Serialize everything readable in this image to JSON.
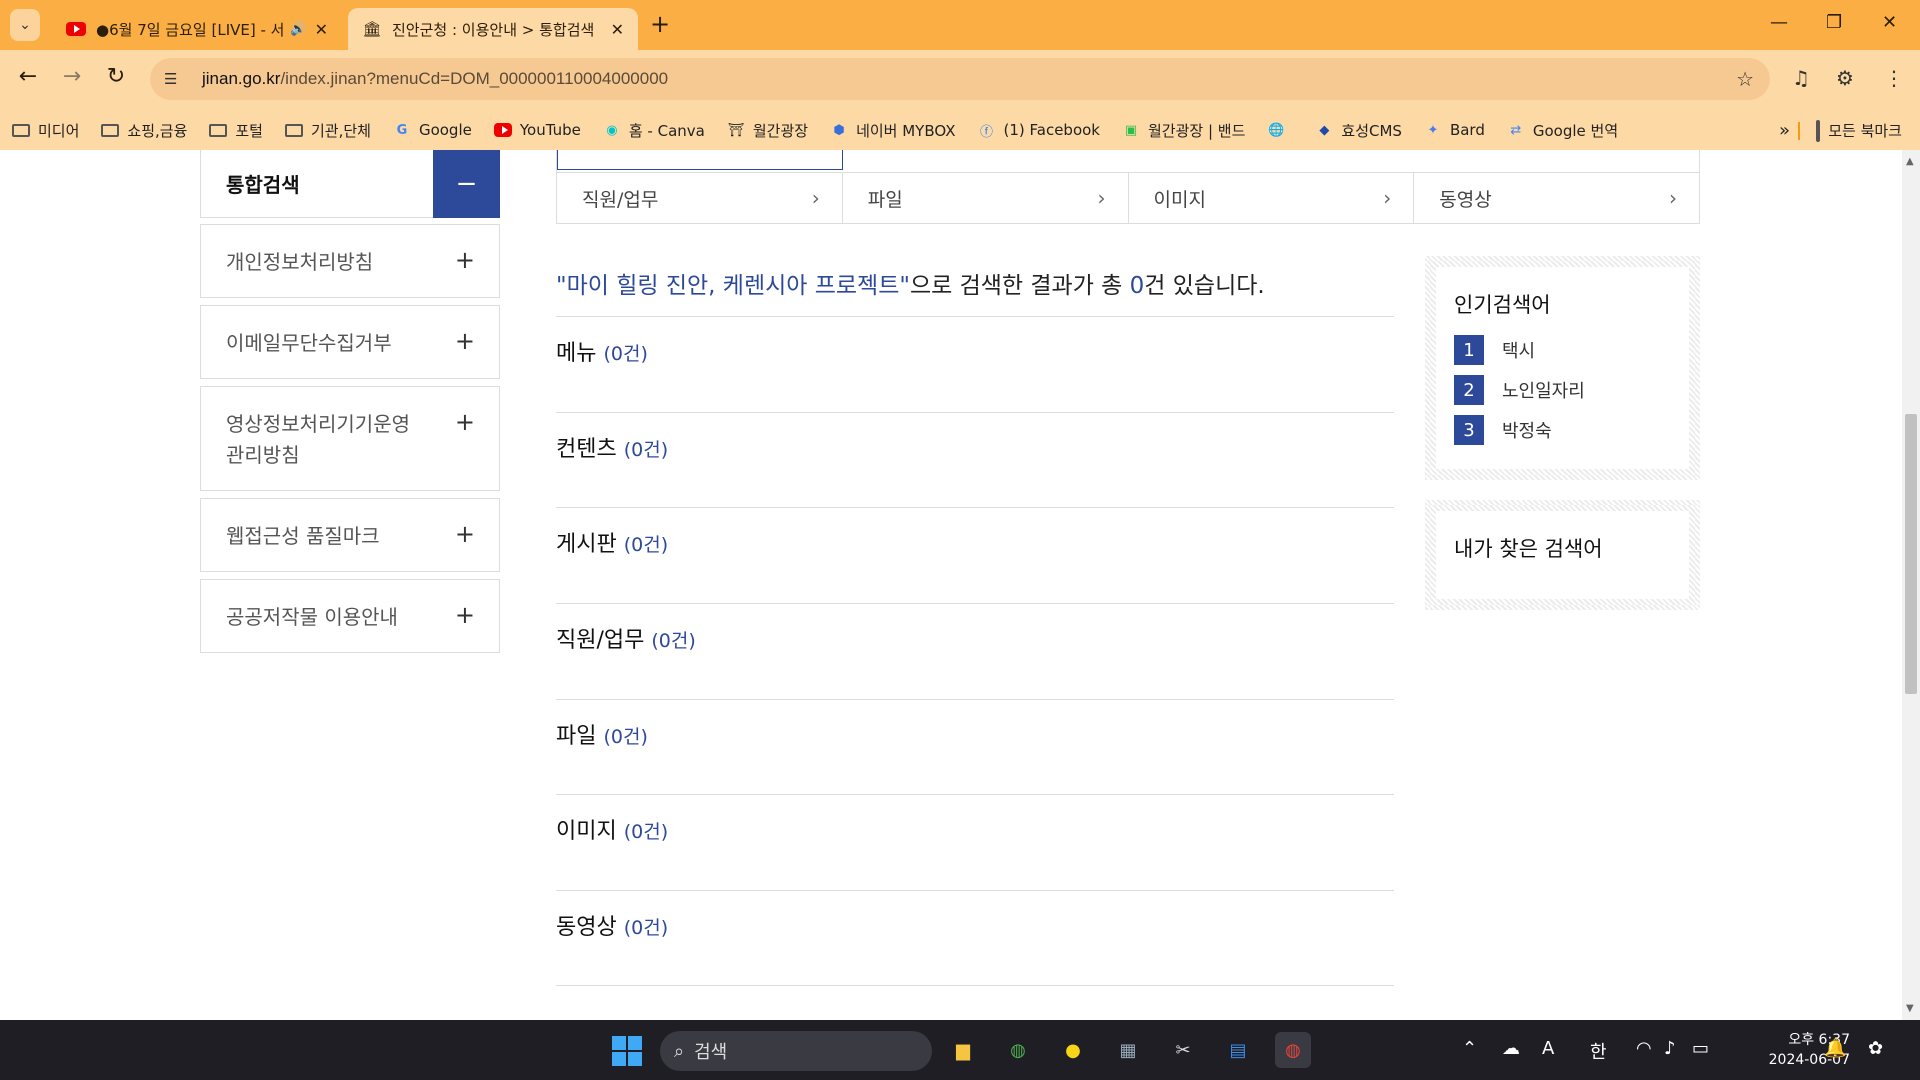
{
  "browser": {
    "tabs": [
      {
        "title": "●6월 7일 금요일 [LIVE] - 서",
        "icon": "youtube-icon",
        "audio": true
      },
      {
        "title": "진안군청 : 이용안내 > 통합검색",
        "icon": "jinan-logo-icon",
        "active": true
      }
    ],
    "url": {
      "host": "jinan.go.kr",
      "path": "/index.jinan?menuCd=DOM_000000110004000000"
    },
    "bookmarks": [
      {
        "label": "미디어",
        "icon": "folder-icon"
      },
      {
        "label": "쇼핑,금융",
        "icon": "folder-icon"
      },
      {
        "label": "포털",
        "icon": "folder-icon"
      },
      {
        "label": "기관,단체",
        "icon": "folder-icon"
      },
      {
        "label": "Google",
        "icon": "google-icon"
      },
      {
        "label": "YouTube",
        "icon": "youtube-icon"
      },
      {
        "label": "홈 - Canva",
        "icon": "canva-icon"
      },
      {
        "label": "월간광장",
        "icon": "site-icon"
      },
      {
        "label": "네이버 MYBOX",
        "icon": "mybox-icon"
      },
      {
        "label": "(1) Facebook",
        "icon": "facebook-icon"
      },
      {
        "label": "월간광장 | 밴드",
        "icon": "band-icon"
      },
      {
        "label": "",
        "icon": "globe-icon"
      },
      {
        "label": "효성CMS",
        "icon": "hyosung-icon"
      },
      {
        "label": "Bard",
        "icon": "bard-icon"
      },
      {
        "label": "Google 번역",
        "icon": "translate-icon"
      }
    ],
    "all_bookmarks": "모든 북마크"
  },
  "sidebar": {
    "header": "통합검색",
    "items": [
      {
        "label": "개인정보처리방침"
      },
      {
        "label": "이메일무단수집거부"
      },
      {
        "label": "영상정보처리기기운영관리방침"
      },
      {
        "label": "웹접근성 품질마크"
      },
      {
        "label": "공공저작물 이용안내"
      }
    ]
  },
  "categories": [
    "직원/업무",
    "파일",
    "이미지",
    "동영상"
  ],
  "summary": {
    "query": "\"마이 힐링 진안, 케렌시아 프로젝트\"",
    "mid": "으로 검색한 결과가 총 ",
    "count": "0",
    "end": "건 있습니다."
  },
  "sections": [
    {
      "title": "메뉴",
      "count": "(0건)"
    },
    {
      "title": "컨텐츠",
      "count": "(0건)"
    },
    {
      "title": "게시판",
      "count": "(0건)"
    },
    {
      "title": "직원/업무",
      "count": "(0건)"
    },
    {
      "title": "파일",
      "count": "(0건)"
    },
    {
      "title": "이미지",
      "count": "(0건)"
    },
    {
      "title": "동영상",
      "count": "(0건)"
    }
  ],
  "popular": {
    "title": "인기검색어",
    "items": [
      {
        "rank": "1",
        "term": "택시"
      },
      {
        "rank": "2",
        "term": "노인일자리"
      },
      {
        "rank": "3",
        "term": "박정숙"
      }
    ]
  },
  "my_searches": {
    "title": "내가 찾은 검색어"
  },
  "taskbar": {
    "search_placeholder": "검색",
    "ime_lang": "A",
    "ime_korean": "한",
    "time": "오후 6:37",
    "date": "2024-06-07"
  },
  "colors": {
    "accent": "#2d4a9a",
    "chrome": "#fbae44"
  }
}
